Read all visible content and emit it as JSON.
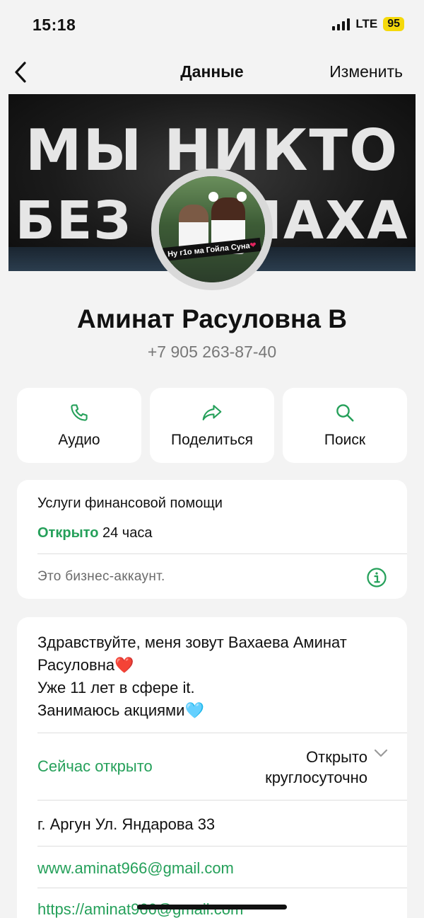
{
  "status_bar": {
    "time": "15:18",
    "network": "LTE",
    "battery": "95"
  },
  "nav": {
    "title": "Данные",
    "edit_label": "Изменить"
  },
  "banner": {
    "line1": "МЫ НИКТО",
    "line2": "БЕЗ АЛЛАХА"
  },
  "avatar": {
    "caption": "Ну г1о ма Гойла Суна"
  },
  "profile": {
    "name": "Аминат Расуловна В",
    "phone": "+7 905 263-87-40"
  },
  "actions": [
    {
      "label": "Аудио",
      "icon": "phone-icon"
    },
    {
      "label": "Поделиться",
      "icon": "share-icon"
    },
    {
      "label": "Поиск",
      "icon": "search-icon"
    }
  ],
  "business": {
    "category": "Услуги финансовой помощи",
    "open_label": "Открыто",
    "hours_label": "24 часа",
    "note": "Это бизнес-аккаунт."
  },
  "about": {
    "lines": [
      "Здравствуйте, меня зовут Вахаева Аминат",
      "Расуловна❤️",
      "Уже 11 лет в сфере it.",
      "Занимаюсь акциями🩵"
    ]
  },
  "schedule": {
    "status": "Сейчас открыто",
    "hours_line1": "Открыто",
    "hours_line2": "круглосуточно"
  },
  "address": "г. Аргун Ул. Яндарова 33",
  "email": "www.aminat966@gmail.com",
  "link": "https://aminat966@gmail.com",
  "colors": {
    "accent": "#25a05a",
    "battery": "#f5d90a",
    "background": "#f3f3f3"
  }
}
